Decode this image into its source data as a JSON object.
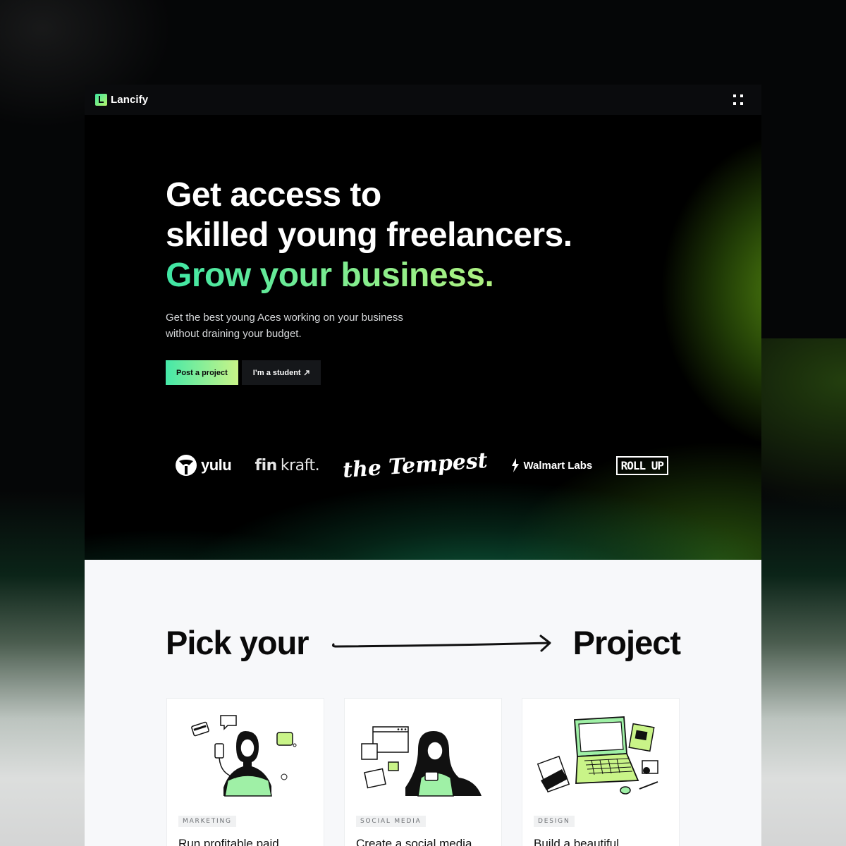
{
  "nav": {
    "brand": "Lancify",
    "menu_icon": "grid-menu-icon"
  },
  "hero": {
    "headline_line1": "Get access to",
    "headline_line2": "skilled young freelancers.",
    "headline_line3": "Grow your business.",
    "subtitle": "Get the best young Aces working on your business without draining your budget.",
    "primary_cta": "Post a project",
    "secondary_cta": "I’m a student",
    "secondary_cta_icon": "arrow-up-right-icon",
    "accent_gradient": [
      "#3fe6a4",
      "#c9f47a"
    ]
  },
  "logos": {
    "yulu": "yulu",
    "finkraft_bold": "fin",
    "finkraft_light": "kraft.",
    "tempest": "the Tempest",
    "walmart": "Walmart Labs",
    "rollup": "ROLL UP"
  },
  "projects": {
    "heading_left": "Pick your",
    "heading_right": "Project",
    "cards": [
      {
        "tag": "MARKETING",
        "title": "Run profitable paid ads"
      },
      {
        "tag": "SOCIAL MEDIA",
        "title": "Create a social media plan"
      },
      {
        "tag": "DESIGN",
        "title": "Build a beautiful website"
      }
    ]
  }
}
